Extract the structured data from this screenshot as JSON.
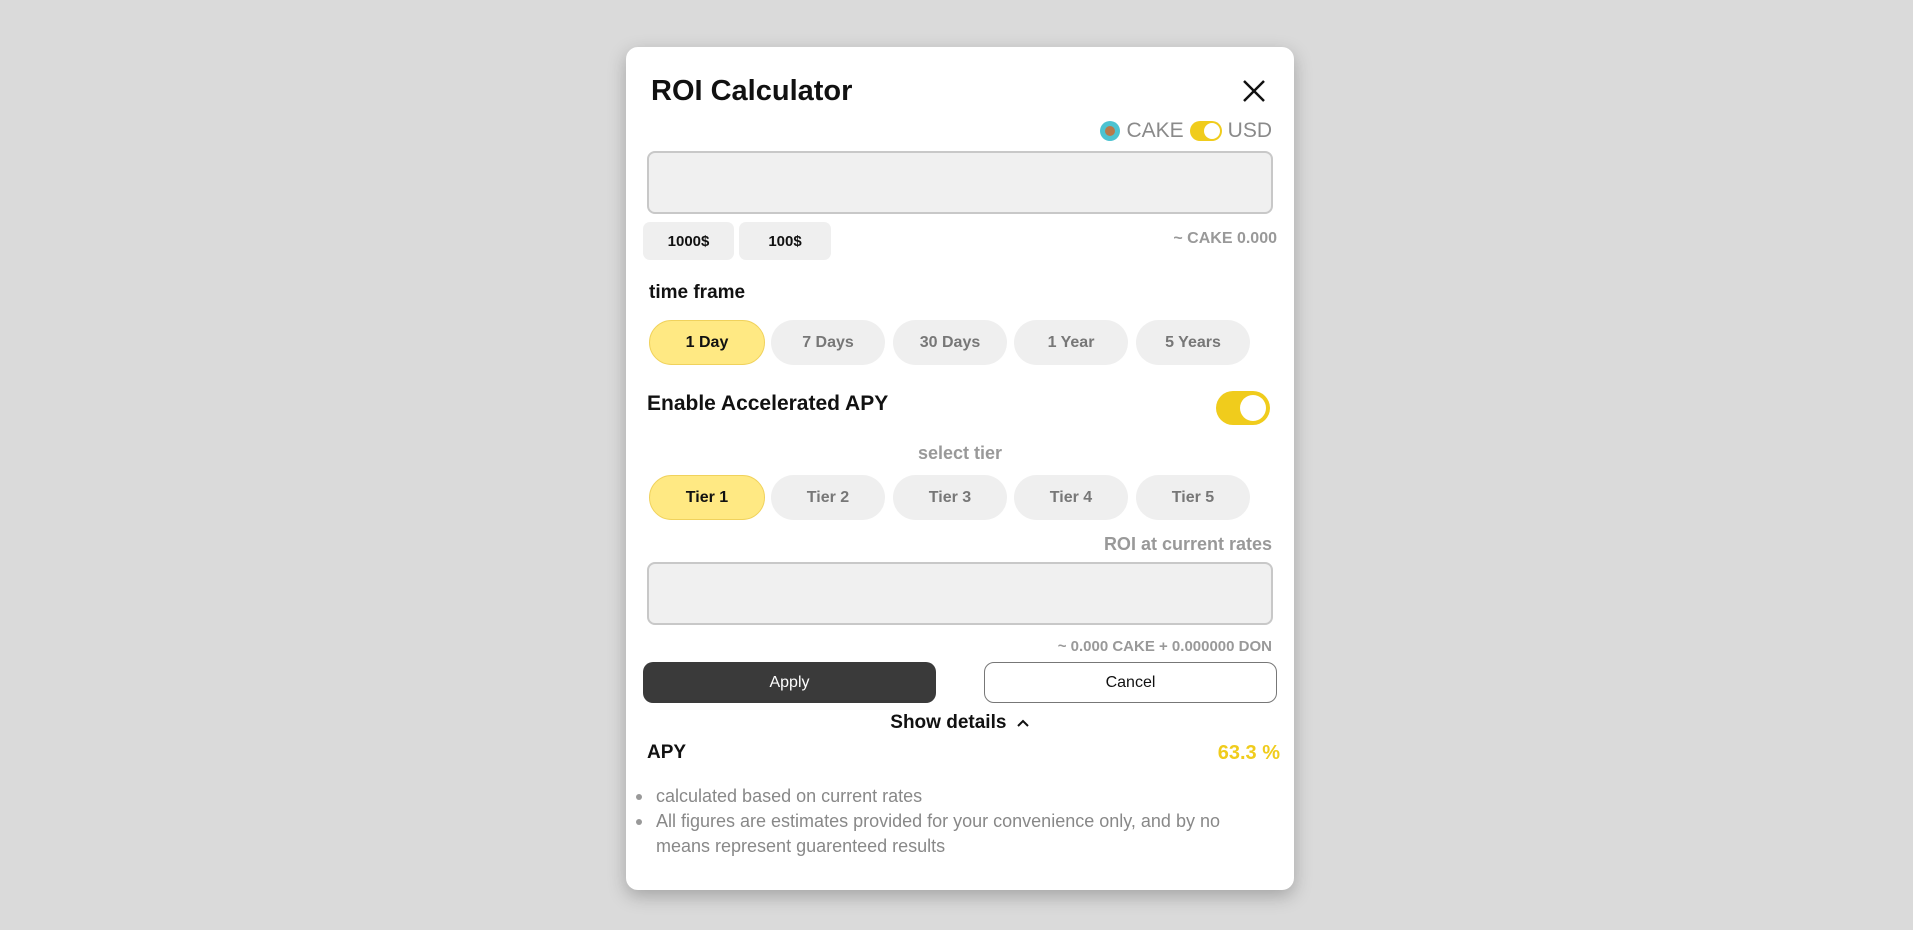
{
  "dialog": {
    "title": "ROI Calculator",
    "close_icon": "close-icon"
  },
  "currency": {
    "token": "CAKE",
    "fiat": "USD",
    "toggle_on": true
  },
  "amount_input": {
    "value": "",
    "presets": [
      "1000$",
      "100$"
    ],
    "approx_text": "~ CAKE 0.000"
  },
  "time_frame": {
    "label": "time frame",
    "options": [
      "1 Day",
      "7 Days",
      "30 Days",
      "1 Year",
      "5 Years"
    ],
    "selected": "1 Day"
  },
  "accelerated": {
    "label": "Enable Accelerated APY",
    "enabled": true,
    "tier_label": "select tier",
    "tiers": [
      "Tier 1",
      "Tier 2",
      "Tier 3",
      "Tier 4",
      "Tier 5"
    ],
    "selected": "Tier 1"
  },
  "roi": {
    "label": "ROI at current rates",
    "value": "",
    "approx_text": "~ 0.000 CAKE + 0.000000 DON"
  },
  "actions": {
    "apply_label": "Apply",
    "cancel_label": "Cancel"
  },
  "details": {
    "toggle_label": "Show details",
    "apy_label": "APY",
    "apy_value": "63.3 %",
    "notes": [
      "calculated based on current rates",
      "All figures are estimates provided for your convenience only, and by no means represent guarenteed results"
    ]
  },
  "colors": {
    "accent": "#f0cc1c",
    "selected_pill": "#ffe983",
    "apply_button": "#3a3a3a"
  }
}
